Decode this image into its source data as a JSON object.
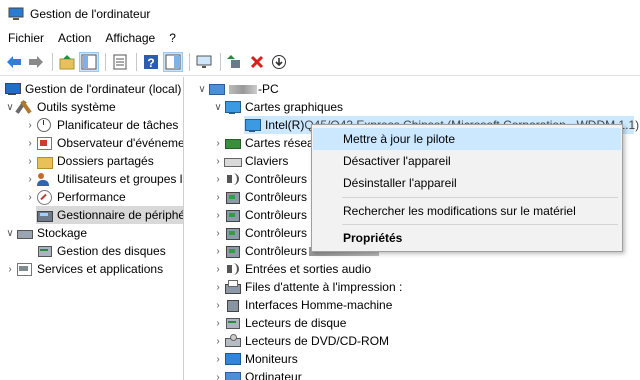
{
  "window": {
    "title": "Gestion de l'ordinateur"
  },
  "menubar": {
    "items": [
      "Fichier",
      "Action",
      "Affichage",
      "?"
    ]
  },
  "toolbar": {
    "buttons": [
      "back-arrow-icon",
      "forward-arrow-icon",
      "up-folder-icon",
      "show-tree-icon",
      "properties-icon",
      "help-icon",
      "action-pane-icon",
      "monitor-icon",
      "update-driver-icon",
      "uninstall-icon",
      "scan-hardware-icon"
    ]
  },
  "left_tree": {
    "root": "Gestion de l'ordinateur (local)",
    "system_tools": "Outils système",
    "task_scheduler": "Planificateur de tâches",
    "event_viewer": "Observateur d'événeme",
    "shared_folders": "Dossiers partagés",
    "users_groups": "Utilisateurs et groupes l",
    "performance": "Performance",
    "device_manager": "Gestionnaire de périphé",
    "storage": "Stockage",
    "disk_management": "Gestion des disques",
    "services_apps": "Services et applications"
  },
  "right_tree": {
    "computer": "-PC",
    "display_adapters": "Cartes graphiques",
    "intel_adapter_prefix": "Intel(R) ",
    "intel_adapter_rest": "Q45/Q43 Express Chipset (Microsoft Corporation - WDDM 1.1)",
    "network_adapters": "Cartes résea",
    "keyboards": "Claviers",
    "controllers_1": "Contrôleurs",
    "controllers_2": "Contrôleurs",
    "controllers_3": "Contrôleurs",
    "controllers_4": "Contrôleurs",
    "controllers_5": "Contrôleurs",
    "audio_io": "Entrées et sorties audio",
    "print_queues": "Files d'attente à l'impression :",
    "hid": "Interfaces Homme-machine",
    "disk_drives": "Lecteurs de disque",
    "dvd_drives": "Lecteurs de DVD/CD-ROM",
    "monitors": "Moniteurs",
    "computers": "Ordinateur"
  },
  "context_menu": {
    "update_driver": "Mettre à jour le pilote",
    "disable_device": "Désactiver l'appareil",
    "uninstall_device": "Désinstaller l'appareil",
    "scan_changes": "Rechercher les modifications sur le matériel",
    "properties": "Propriétés"
  }
}
